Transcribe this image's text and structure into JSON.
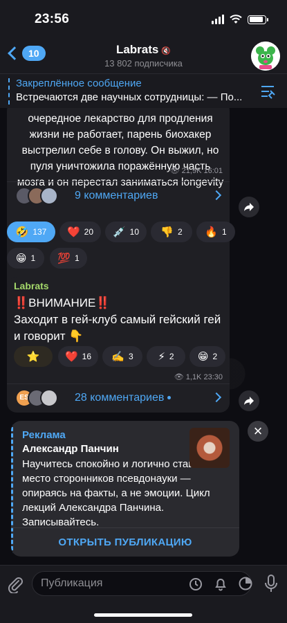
{
  "status_bar": {
    "time": "23:56",
    "battery_level": 0.9
  },
  "nav": {
    "back_badge": "10",
    "title": "Labrats",
    "subscribers": "13 802 подписчика"
  },
  "pinned": {
    "label": "Закреплённое сообщение",
    "text": "Встречаются две научных сотрудницы: — По..."
  },
  "post1": {
    "text": "очередное лекарство для продления жизни не работает, парень биохакер выстрелил себе в голову. Он выжил, но пуля уничтожила поражённую часть мозга и он перестал заниматься longevity",
    "views": "21,9K",
    "time": "16:01",
    "comments": "9 комментариев",
    "reactions": [
      {
        "emoji": "🤣",
        "count": "137",
        "active": true
      },
      {
        "emoji": "❤️",
        "count": "20"
      },
      {
        "emoji": "💉",
        "count": "10"
      },
      {
        "emoji": "👎",
        "count": "2"
      },
      {
        "emoji": "🔥",
        "count": "1"
      },
      {
        "emoji": "😁",
        "count": "1"
      },
      {
        "emoji": "💯",
        "count": "1"
      }
    ]
  },
  "post2": {
    "author": "Labrats",
    "line1": "‼️ВНИМАНИЕ‼️",
    "line2": "Заходит в гей-клуб самый гейский гей и говорит 👇",
    "views": "1,1K",
    "time": "23:30",
    "comments": "28 комментариев",
    "comment_avatar_initials": "ES",
    "reactions": [
      {
        "emoji": "⭐",
        "count": ""
      },
      {
        "emoji": "❤️",
        "count": "16"
      },
      {
        "emoji": "✍️",
        "count": "3"
      },
      {
        "emoji": "⚡",
        "count": "2"
      },
      {
        "emoji": "😁",
        "count": "2"
      }
    ]
  },
  "ad": {
    "label": "Реклама",
    "name": "Александр Панчин",
    "text": "Научитесь спокойно и логично ставить на место сторонников псевдонауки — опираясь на факты, а не эмоции. Цикл лекций Александра Панчина. Записывайтесь.",
    "action": "ОТКРЫТЬ ПУБЛИКАЦИЮ",
    "close": "×"
  },
  "composer": {
    "placeholder": "Публикация"
  },
  "colors": {
    "accent": "#4fa8f5",
    "author": "#a5d96b"
  }
}
